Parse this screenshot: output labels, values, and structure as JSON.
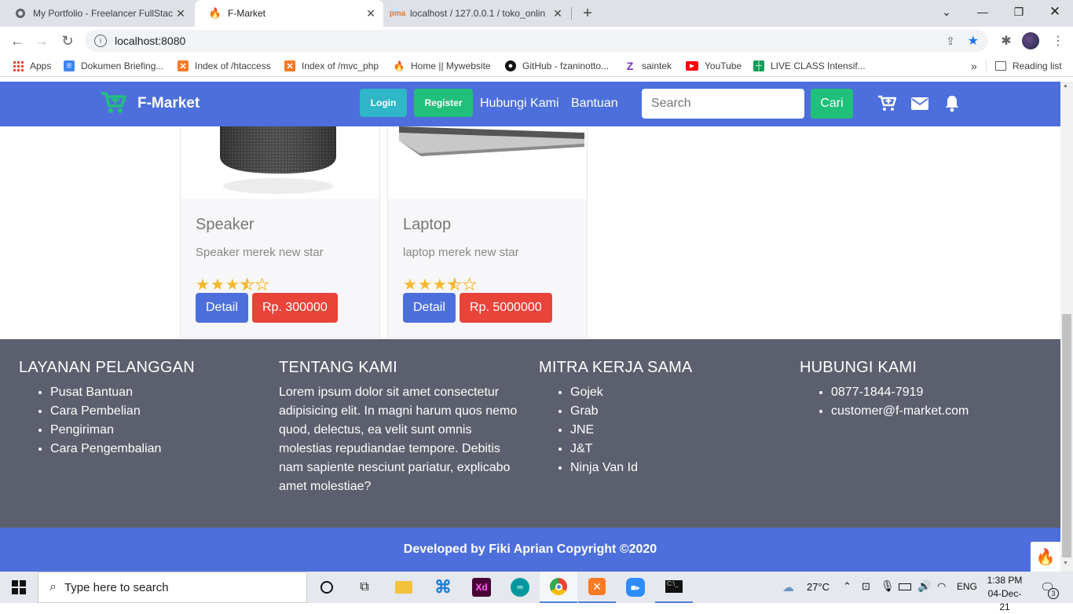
{
  "browser": {
    "tabs": [
      {
        "title": "My Portfolio - Freelancer FullStac",
        "icon": "globe-icon"
      },
      {
        "title": "F-Market",
        "icon": "codeigniter-icon"
      },
      {
        "title": "localhost / 127.0.0.1 / toko_onlin",
        "icon": "phpmyadmin-icon"
      }
    ],
    "new_tab": "+",
    "url": "localhost:8080",
    "bookmarks": [
      {
        "label": "Apps",
        "icon": "apps-grid-icon"
      },
      {
        "label": "Dokumen Briefing...",
        "icon": "docs-icon",
        "color": "#4285f4"
      },
      {
        "label": "Index of /htaccess",
        "icon": "xampp-icon",
        "color": "#fb7a24"
      },
      {
        "label": "Index of /mvc_php",
        "icon": "xampp-icon",
        "color": "#fb7a24"
      },
      {
        "label": "Home || Mywebsite",
        "icon": "codeigniter-icon"
      },
      {
        "label": "GitHub - fzaninotto...",
        "icon": "github-icon"
      },
      {
        "label": "saintek",
        "icon": "zenius-icon"
      },
      {
        "label": "YouTube",
        "icon": "youtube-icon",
        "color": "#ff0000"
      },
      {
        "label": "LIVE CLASS Intensif...",
        "icon": "sheets-icon",
        "color": "#0f9d58"
      }
    ],
    "more_bookmarks": "»",
    "reading_list": "Reading list"
  },
  "site": {
    "brand": "F-Market",
    "nav": {
      "login": "Login",
      "register": "Register",
      "contact": "Hubungi Kami",
      "help": "Bantuan"
    },
    "search": {
      "placeholder": "Search",
      "button": "Cari"
    },
    "products": [
      {
        "name": "Speaker",
        "description": "Speaker merek new star",
        "rating": 3.5,
        "detail": "Detail",
        "price": "Rp. 300000"
      },
      {
        "name": "Laptop",
        "description": "laptop merek new star",
        "rating": 3.5,
        "detail": "Detail",
        "price": "Rp. 5000000"
      }
    ],
    "footer": {
      "service": {
        "title": "LAYANAN PELANGGAN",
        "items": [
          "Pusat Bantuan",
          "Cara Pembelian",
          "Pengiriman",
          "Cara Pengembalian"
        ]
      },
      "about": {
        "title": "TENTANG KAMI",
        "text": "Lorem ipsum dolor sit amet consectetur adipisicing elit. In magni harum quos nemo quod, delectus, ea velit sunt omnis molestias repudiandae tempore. Debitis nam sapiente nesciunt pariatur, explicabo amet molestiae?"
      },
      "partners": {
        "title": "MITRA KERJA SAMA",
        "items": [
          "Gojek",
          "Grab",
          "JNE",
          "J&T",
          "Ninja Van Id"
        ]
      },
      "contact": {
        "title": "HUBUNGI KAMI",
        "items": [
          "0877-1844-7919",
          "customer@f-market.com"
        ]
      }
    },
    "copyright": "Developed by Fiki Aprian Copyright ©2020"
  },
  "taskbar": {
    "search_placeholder": "Type here to search",
    "weather": "27°C",
    "language": "ENG",
    "time": "1:38 PM",
    "date": "04-Dec-21",
    "notifications": "3"
  },
  "colors": {
    "primary": "#4d6fdc",
    "success": "#20c07a",
    "info": "#2fb6c8",
    "danger": "#e8443a",
    "footer": "#5c5f6d",
    "star": "#f4b82a"
  }
}
